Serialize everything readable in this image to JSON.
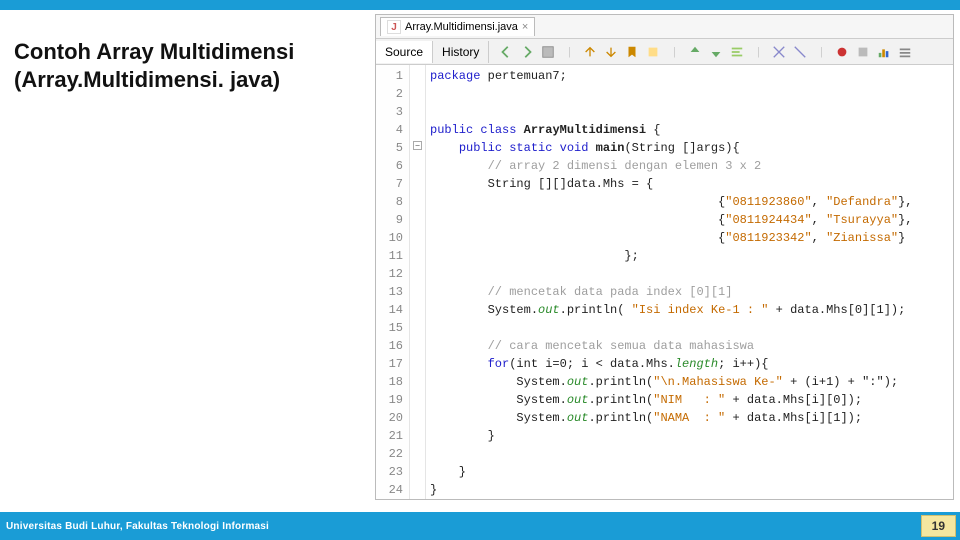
{
  "slide": {
    "title_line1": "Contoh Array Multidimensi",
    "title_line2": "(Array.Multidimensi. java)"
  },
  "editor": {
    "tab": {
      "filename": "Array.Multidimensi.java"
    },
    "views": {
      "source": "Source",
      "history": "History"
    },
    "lines": [
      1,
      2,
      3,
      4,
      5,
      6,
      7,
      8,
      9,
      10,
      11,
      12,
      13,
      14,
      15,
      16,
      17,
      18,
      19,
      20,
      21,
      22,
      23,
      24
    ],
    "fold_at": 5,
    "code": {
      "l1": {
        "kw": "package",
        "rest": " pertemuan7;"
      },
      "l4a": {
        "kw1": "public",
        "kw2": "class",
        "cls": "ArrayMultidimensi",
        "brace": " {"
      },
      "l5": {
        "kw1": "public",
        "kw2": "static",
        "kw3": "void",
        "method": "main",
        "params": "(String []args){"
      },
      "l6": {
        "cmt": "// array 2 dimensi dengan elemen 3 x 2"
      },
      "l7": {
        "txt": "String [][]data.Mhs = {"
      },
      "l8": {
        "pre": "{",
        "s1": "\"0811923860\"",
        ",": ", ",
        "s2": "\"Defandra\"",
        "post": "},"
      },
      "l9": {
        "pre": "{",
        "s1": "\"0811924434\"",
        ",": ", ",
        "s2": "\"Tsurayya\"",
        "post": "},"
      },
      "l10": {
        "pre": "{",
        "s1": "\"0811923342\"",
        ",": ", ",
        "s2": "\"Zianissa\"",
        "post": "}"
      },
      "l11": {
        "txt": "};"
      },
      "l13": {
        "cmt": "// mencetak data pada index [0][1]"
      },
      "l14": {
        "pre": "System.",
        "fld": "out",
        ".": ".println( ",
        "s": "\"Isi index Ke-1 : \"",
        "post": " + data.Mhs[0][1]);"
      },
      "l16": {
        "cmt": "// cara mencetak semua data mahasiswa"
      },
      "l17": {
        "kw": "for",
        "txt": "(int i=0; i < data.Mhs.",
        "fld": "length",
        "post": "; i++){"
      },
      "l18": {
        "pre": "System.",
        "fld": "out",
        ".": ".println(",
        "s": "\"\\n.Mahasiswa Ke-\"",
        "post": " + (i+1) + \":\");"
      },
      "l19": {
        "pre": "System.",
        "fld": "out",
        ".": ".println(",
        "s": "\"NIM   : \"",
        "post": " + data.Mhs[i][0]);"
      },
      "l20": {
        "pre": "System.",
        "fld": "out",
        ".": ".println(",
        "s": "\"NAMA  : \"",
        "post": " + data.Mhs[i][1]);"
      },
      "l21": {
        "txt": "}"
      },
      "l23": {
        "txt": "}"
      },
      "l24": {
        "txt": "}"
      }
    }
  },
  "footer": {
    "university": "Universitas Budi Luhur, Fakultas Teknologi Informasi",
    "page": "19"
  }
}
